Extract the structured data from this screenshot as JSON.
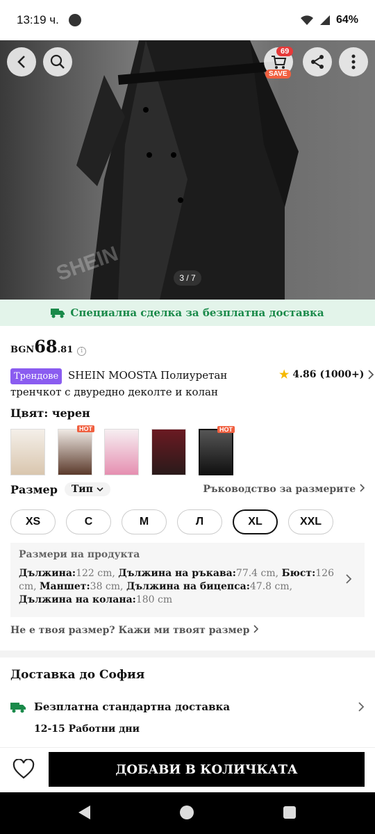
{
  "status": {
    "time": "13:19 ч.",
    "battery": "64%"
  },
  "gallery": {
    "counter": "3 / 7",
    "cart_count": "69",
    "save_label": "SAVE",
    "watermark": "SHEIN"
  },
  "deal_banner": "Специална сделка за безплатна доставка",
  "price": {
    "currency": "BGN",
    "integer": "68",
    "decimal": ".81"
  },
  "product": {
    "trend_badge": "Трендове",
    "title": "SHEIN MOOSTA Полиуретан тренчкот с двуредно деколте и колан",
    "rating": "4.86",
    "reviews": "(1000+)"
  },
  "color": {
    "label": "Цвят: черен",
    "hot_label": "HOT"
  },
  "size": {
    "label": "Размер",
    "type": "Тип",
    "guide": "Ръководство за размерите",
    "options": [
      "XS",
      "C",
      "M",
      "Л",
      "XL",
      "XXL"
    ],
    "selected": "XL"
  },
  "measurements": {
    "heading": "Размери на продукта",
    "items": [
      {
        "k": "Дължина:",
        "v": "122 cm, "
      },
      {
        "k": "Дължина на ръкава:",
        "v": "77.4 cm, "
      },
      {
        "k": "Бюст:",
        "v": "126 cm, "
      },
      {
        "k": "Маншет:",
        "v": "38 cm, "
      },
      {
        "k": "Дължина на бицепса:",
        "v": "47.8 cm, "
      },
      {
        "k": "Дължина на колана:",
        "v": "180 cm"
      }
    ]
  },
  "not_size": "Не е твоя размер? Кажи ми твоят размер",
  "delivery": {
    "heading": "Доставка до София",
    "method": "Безплатна стандартна доставка",
    "days": "12-15 Работни дни"
  },
  "add_to_cart": "ДОБАВИ В КОЛИЧКАТА",
  "colors": {
    "deal_green": "#1a8a4a",
    "trend_purple": "#8a5cf0",
    "hot_orange": "#f06040"
  }
}
